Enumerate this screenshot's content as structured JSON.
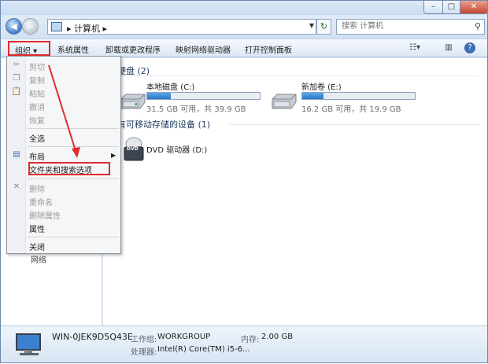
{
  "window": {
    "controls": {
      "minimize": "–",
      "maximize": "□",
      "close": "✕"
    }
  },
  "nav": {
    "address_parts": [
      "计算机"
    ],
    "search_placeholder": "搜索 计算机"
  },
  "toolbar": {
    "organize": "组织 ▾",
    "items": [
      "系统属性",
      "卸载或更改程序",
      "映射网络驱动器",
      "打开控制面板"
    ]
  },
  "groups": {
    "hard_disks": "硬盘 (2)",
    "removable": "有可移动存储的设备 (1)"
  },
  "drives": [
    {
      "name": "本地磁盘 (C:)",
      "free": "31.5 GB 可用，共 39.9 GB",
      "used_fraction": 0.21
    },
    {
      "name": "新加卷 (E:)",
      "free": "16.2 GB 可用，共 19.9 GB",
      "used_fraction": 0.19
    }
  ],
  "dvd": {
    "name": "DVD 驱动器 (D:)",
    "badge": "DVD"
  },
  "menu": {
    "items": [
      {
        "label": "剪切",
        "enabled": false
      },
      {
        "label": "复制",
        "enabled": false
      },
      {
        "label": "粘贴",
        "enabled": false
      },
      {
        "label": "撤消",
        "enabled": false
      },
      {
        "label": "恢复",
        "enabled": false
      },
      {
        "label": "全选",
        "enabled": true
      },
      {
        "label": "布局",
        "enabled": true
      },
      {
        "label": "文件夹和搜索选项",
        "enabled": true
      },
      {
        "label": "删除",
        "enabled": false
      },
      {
        "label": "重命名",
        "enabled": false
      },
      {
        "label": "删除属性",
        "enabled": false
      },
      {
        "label": "属性",
        "enabled": true
      },
      {
        "label": "关闭",
        "enabled": true
      }
    ]
  },
  "left_pane_partial": "网络",
  "status": {
    "computer_name": "WIN-0JEK9D5Q43E",
    "workgroup_label": "工作组:",
    "workgroup": "WORKGROUP",
    "memory_label": "内存:",
    "memory": "2.00 GB",
    "cpu_label": "处理器:",
    "cpu": "Intel(R) Core(TM) i5-6..."
  },
  "colors": {
    "annotation_red": "#e12a2a",
    "progress_blue": "#2a78c9"
  }
}
